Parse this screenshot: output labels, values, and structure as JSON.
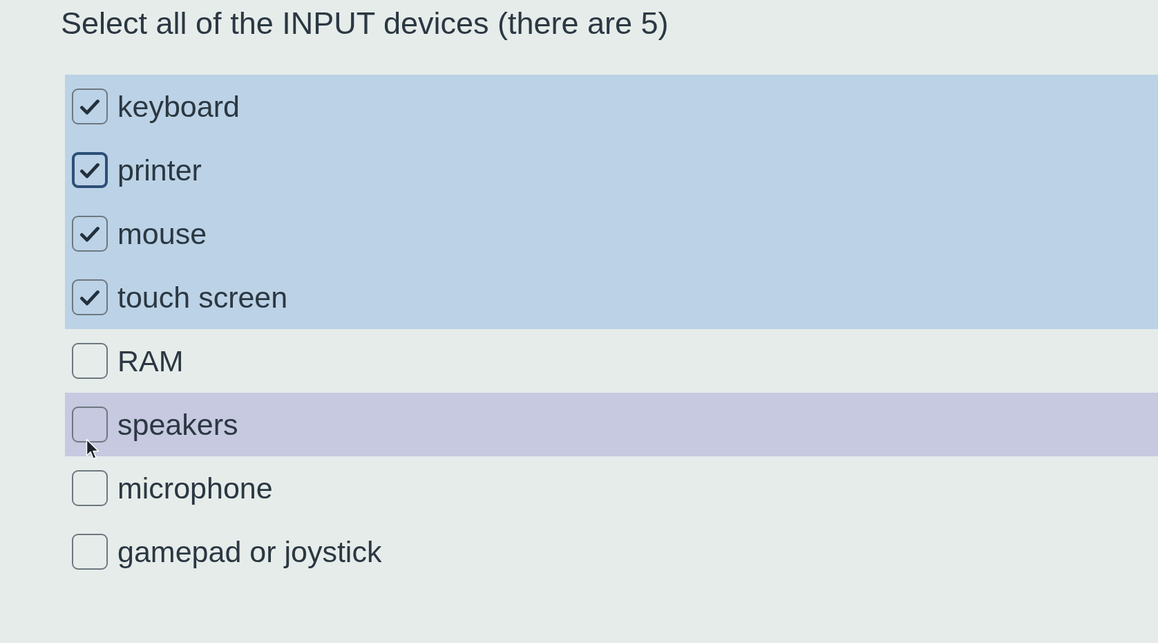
{
  "question": "Select all of the INPUT devices (there are 5)",
  "options": [
    {
      "label": "keyboard",
      "checked": true,
      "focused": false,
      "hovered": false
    },
    {
      "label": "printer",
      "checked": true,
      "focused": true,
      "hovered": false
    },
    {
      "label": "mouse",
      "checked": true,
      "focused": false,
      "hovered": false
    },
    {
      "label": "touch screen",
      "checked": true,
      "focused": false,
      "hovered": false
    },
    {
      "label": "RAM",
      "checked": false,
      "focused": false,
      "hovered": false
    },
    {
      "label": "speakers",
      "checked": false,
      "focused": false,
      "hovered": true
    },
    {
      "label": "microphone",
      "checked": false,
      "focused": false,
      "hovered": false
    },
    {
      "label": "gamepad or joystick",
      "checked": false,
      "focused": false,
      "hovered": false
    }
  ]
}
